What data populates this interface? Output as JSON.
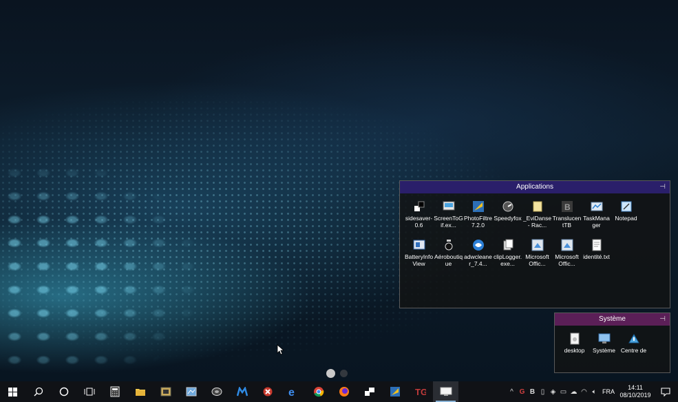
{
  "fences": {
    "applications": {
      "title": "Applications",
      "title_color": "#2a1f6a",
      "items": [
        {
          "label": "sidesaver-0.6",
          "icon": "sidesaver-icon"
        },
        {
          "label": "ScreenToGif.ex...",
          "icon": "screentogif-icon"
        },
        {
          "label": "PhotoFiltre 7.2.0",
          "icon": "photofiltre-icon"
        },
        {
          "label": "Speedyfox",
          "icon": "speedyfox-icon"
        },
        {
          "label": "_EviDanse - Rac...",
          "icon": "folder-shortcut-icon"
        },
        {
          "label": "TranslucentTB",
          "icon": "translucenttb-icon"
        },
        {
          "label": "TaskManager",
          "icon": "taskmanager-icon"
        },
        {
          "label": "Notepad",
          "icon": "notepad-icon"
        },
        {
          "label": "BatteryInfoView",
          "icon": "batteryinfoview-icon"
        },
        {
          "label": "Aéroboutique",
          "icon": "aeroboutique-icon"
        },
        {
          "label": "adwcleaner_7.4...",
          "icon": "adwcleaner-icon"
        },
        {
          "label": "clipLogger.exe...",
          "icon": "cliplogger-icon"
        },
        {
          "label": "Microsoft Offic...",
          "icon": "office-shortcut-icon"
        },
        {
          "label": "Microsoft Offic...",
          "icon": "office-shortcut-icon"
        },
        {
          "label": "identité.txt",
          "icon": "text-file-icon"
        }
      ]
    },
    "systeme": {
      "title": "Système",
      "title_color": "#5b1f57",
      "items": [
        {
          "label": "desktop",
          "icon": "desktop-file-icon"
        },
        {
          "label": "Système",
          "icon": "system-icon"
        },
        {
          "label": "Centre de",
          "icon": "action-center-icon"
        }
      ]
    },
    "pin_glyph": "⊣"
  },
  "pager": {
    "pages": 2,
    "current": 1
  },
  "taskbar": {
    "apps": [
      {
        "name": "start-button",
        "glyph": "start"
      },
      {
        "name": "search-button",
        "glyph": "search"
      },
      {
        "name": "cortana-button",
        "glyph": "cortana"
      },
      {
        "name": "task-view-button",
        "glyph": "taskview"
      },
      {
        "name": "calculator-app",
        "glyph": "calc"
      },
      {
        "name": "file-explorer-app",
        "glyph": "folder"
      },
      {
        "name": "photos-app",
        "glyph": "photos"
      },
      {
        "name": "control-panel-app",
        "glyph": "cpanel"
      },
      {
        "name": "speedyfox-app",
        "glyph": "speedy"
      },
      {
        "name": "malwarebytes-app",
        "glyph": "malware"
      },
      {
        "name": "ccleaner-app",
        "glyph": "ccleaner"
      },
      {
        "name": "edge-app",
        "glyph": "edge"
      },
      {
        "name": "chrome-app",
        "glyph": "chrome"
      },
      {
        "name": "firefox-app",
        "glyph": "firefox"
      },
      {
        "name": "sidesaver-app",
        "glyph": "sidesaver"
      },
      {
        "name": "photofiltre-app",
        "glyph": "photofiltre"
      },
      {
        "name": "tg-app",
        "glyph": "tg"
      },
      {
        "name": "desktop-app",
        "glyph": "desktopapp"
      }
    ],
    "tray": {
      "language": "FRA",
      "time": "14:11",
      "date": "08/10/2019"
    }
  }
}
